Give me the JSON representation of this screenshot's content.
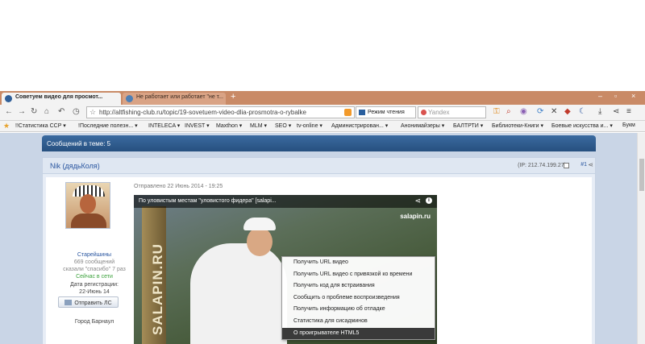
{
  "browser": {
    "tabs": [
      {
        "title": "Советуем видео для просмот...",
        "active": true
      },
      {
        "title": "Не работает или работает \"не т...",
        "active": false
      }
    ],
    "new_tab": "+",
    "window_controls": [
      "–",
      "▫",
      "×"
    ],
    "address": "http://altfishing-club.ru/topic/19-sovetuem-video-dlia-prosmotra-o-rybalke",
    "reading_mode": "Режим чтения",
    "search_placeholder": "Yandex",
    "bookmarks_label": "Букм"
  },
  "bookmarks": [
    "!!Статистика CCP ▾",
    "!Последние полезн... ▾",
    "INTELECA ▾",
    "INVEST ▾",
    "Maxthon ▾",
    "MLM ▾",
    "SEO ▾",
    "tv-online ▾",
    "Администрирован... ▾",
    "Анонимайзеры ▾",
    "БАЛТРТИ ▾",
    "Библиотеки-Книги ▾",
    "Боевые искусства и... ▾"
  ],
  "forum": {
    "messages_in_topic": "Сообщений в теме: 5",
    "post": {
      "author": "Nik (дядьКоля)",
      "ip": "(IP: 212.74.199.27)",
      "number": "#1",
      "date": "Отправлено 22 Июнь 2014 - 19:25",
      "rank": "Старейшины",
      "message_count": "669 сообщений",
      "thanks": "сказали \"спасибо\" 7 раз",
      "online_status": "Сейчас в сети",
      "reg_label": "Дата регистрации:",
      "reg_date": "22-Июнь 14",
      "send_pm": "Отправить ЛС",
      "city": "Город Барнаул"
    }
  },
  "video": {
    "title": "По уловистым местам \"уловистого фидера\" [salapi...",
    "banner_text": "SALAPIN.RU",
    "logo": "salapin.ru",
    "context_menu": [
      {
        "label": "Получить URL видео",
        "active": false
      },
      {
        "label": "Получить URL видео с привязкой ко времени",
        "active": false
      },
      {
        "label": "Получить код для встраивания",
        "active": false
      },
      {
        "label": "Сообщить о проблеме воспроизведения",
        "active": false
      },
      {
        "label": "Получить информацию об отладке",
        "active": false
      },
      {
        "label": "Статистика для сисадминов",
        "active": false
      },
      {
        "label": "О проигрывателе HTML5",
        "active": true
      }
    ]
  },
  "colors": {
    "tab_strip": "#c98a66",
    "forum_header": "#2f5d92",
    "page_bg": "#c9d5e6",
    "online": "#3aa13a"
  }
}
